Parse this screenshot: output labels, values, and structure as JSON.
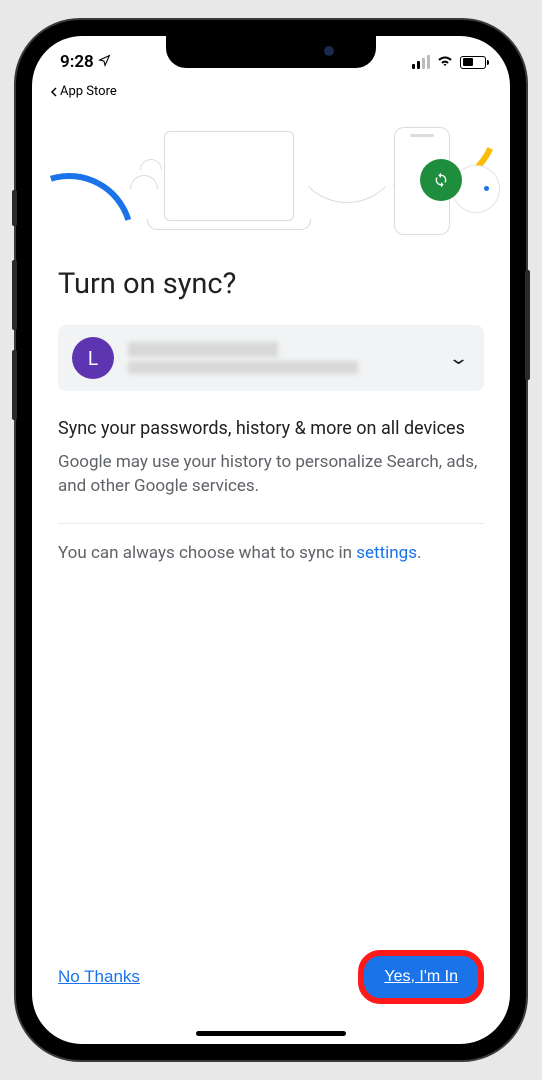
{
  "status": {
    "time": "9:28",
    "back_app_label": "App Store"
  },
  "page": {
    "title": "Turn on sync?",
    "account": {
      "avatar_initial": "L"
    },
    "heading": "Sync your passwords, history & more on all devices",
    "subtext": "Google may use your history to personalize Search, ads, and other Google services.",
    "settings_prefix": "You can always choose what to sync in ",
    "settings_link": "settings",
    "settings_suffix": "."
  },
  "footer": {
    "decline_label": "No Thanks",
    "accept_label": "Yes, I'm In"
  }
}
